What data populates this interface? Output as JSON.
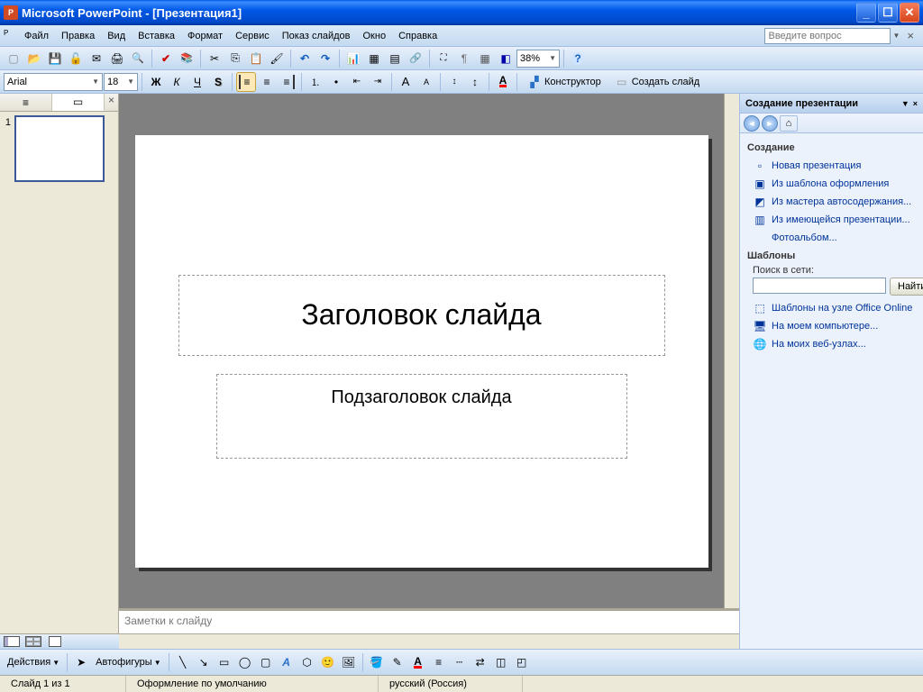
{
  "app": {
    "title": "Microsoft PowerPoint - [Презентация1]"
  },
  "menu": {
    "file": "Файл",
    "edit": "Правка",
    "view": "Вид",
    "insert": "Вставка",
    "format": "Формат",
    "tools": "Сервис",
    "slideshow": "Показ слайдов",
    "window": "Окно",
    "help": "Справка",
    "question_placeholder": "Введите вопрос"
  },
  "format_toolbar": {
    "font": "Arial",
    "size": "18",
    "zoom": "38%",
    "designer_label": "Конструктор",
    "new_slide_label": "Создать слайд"
  },
  "thumbs": {
    "items": [
      {
        "num": "1"
      }
    ]
  },
  "slide": {
    "title_placeholder": "Заголовок слайда",
    "subtitle_placeholder": "Подзаголовок слайда"
  },
  "notes": {
    "placeholder": "Заметки к слайду"
  },
  "taskpane": {
    "title": "Создание презентации",
    "section_create": "Создание",
    "link_new": "Новая презентация",
    "link_from_template": "Из шаблона оформления",
    "link_from_wizard": "Из мастера автосодержания...",
    "link_from_existing": "Из имеющейся презентации...",
    "link_photoalbum": "Фотоальбом...",
    "section_templates": "Шаблоны",
    "search_label": "Поиск в сети:",
    "search_btn": "Найти",
    "link_office_online": "Шаблоны на узле Office Online",
    "link_on_computer": "На моем компьютере...",
    "link_on_web": "На моих веб-узлах..."
  },
  "drawbar": {
    "actions": "Действия",
    "autoshapes": "Автофигуры"
  },
  "status": {
    "slide_info": "Слайд 1 из 1",
    "design": "Оформление по умолчанию",
    "language": "русский (Россия)"
  }
}
